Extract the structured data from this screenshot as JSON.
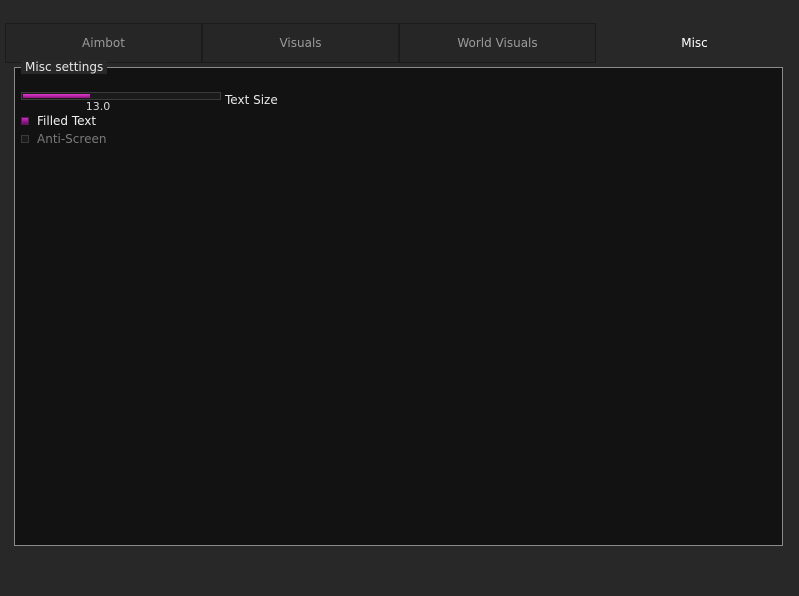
{
  "tabs": [
    {
      "label": "Aimbot",
      "active": false
    },
    {
      "label": "Visuals",
      "active": false
    },
    {
      "label": "World Visuals",
      "active": false
    },
    {
      "label": "Misc",
      "active": true
    }
  ],
  "group": {
    "title": "Misc settings"
  },
  "slider": {
    "label": "Text Size",
    "value_text": "13.0",
    "fill_fraction": 0.34
  },
  "checkboxes": [
    {
      "label": "Filled Text",
      "checked": true
    },
    {
      "label": "Anti-Screen",
      "checked": false
    }
  ],
  "colors": {
    "accent": "#c92cc0",
    "background": "#282828",
    "panel": "#121212"
  }
}
